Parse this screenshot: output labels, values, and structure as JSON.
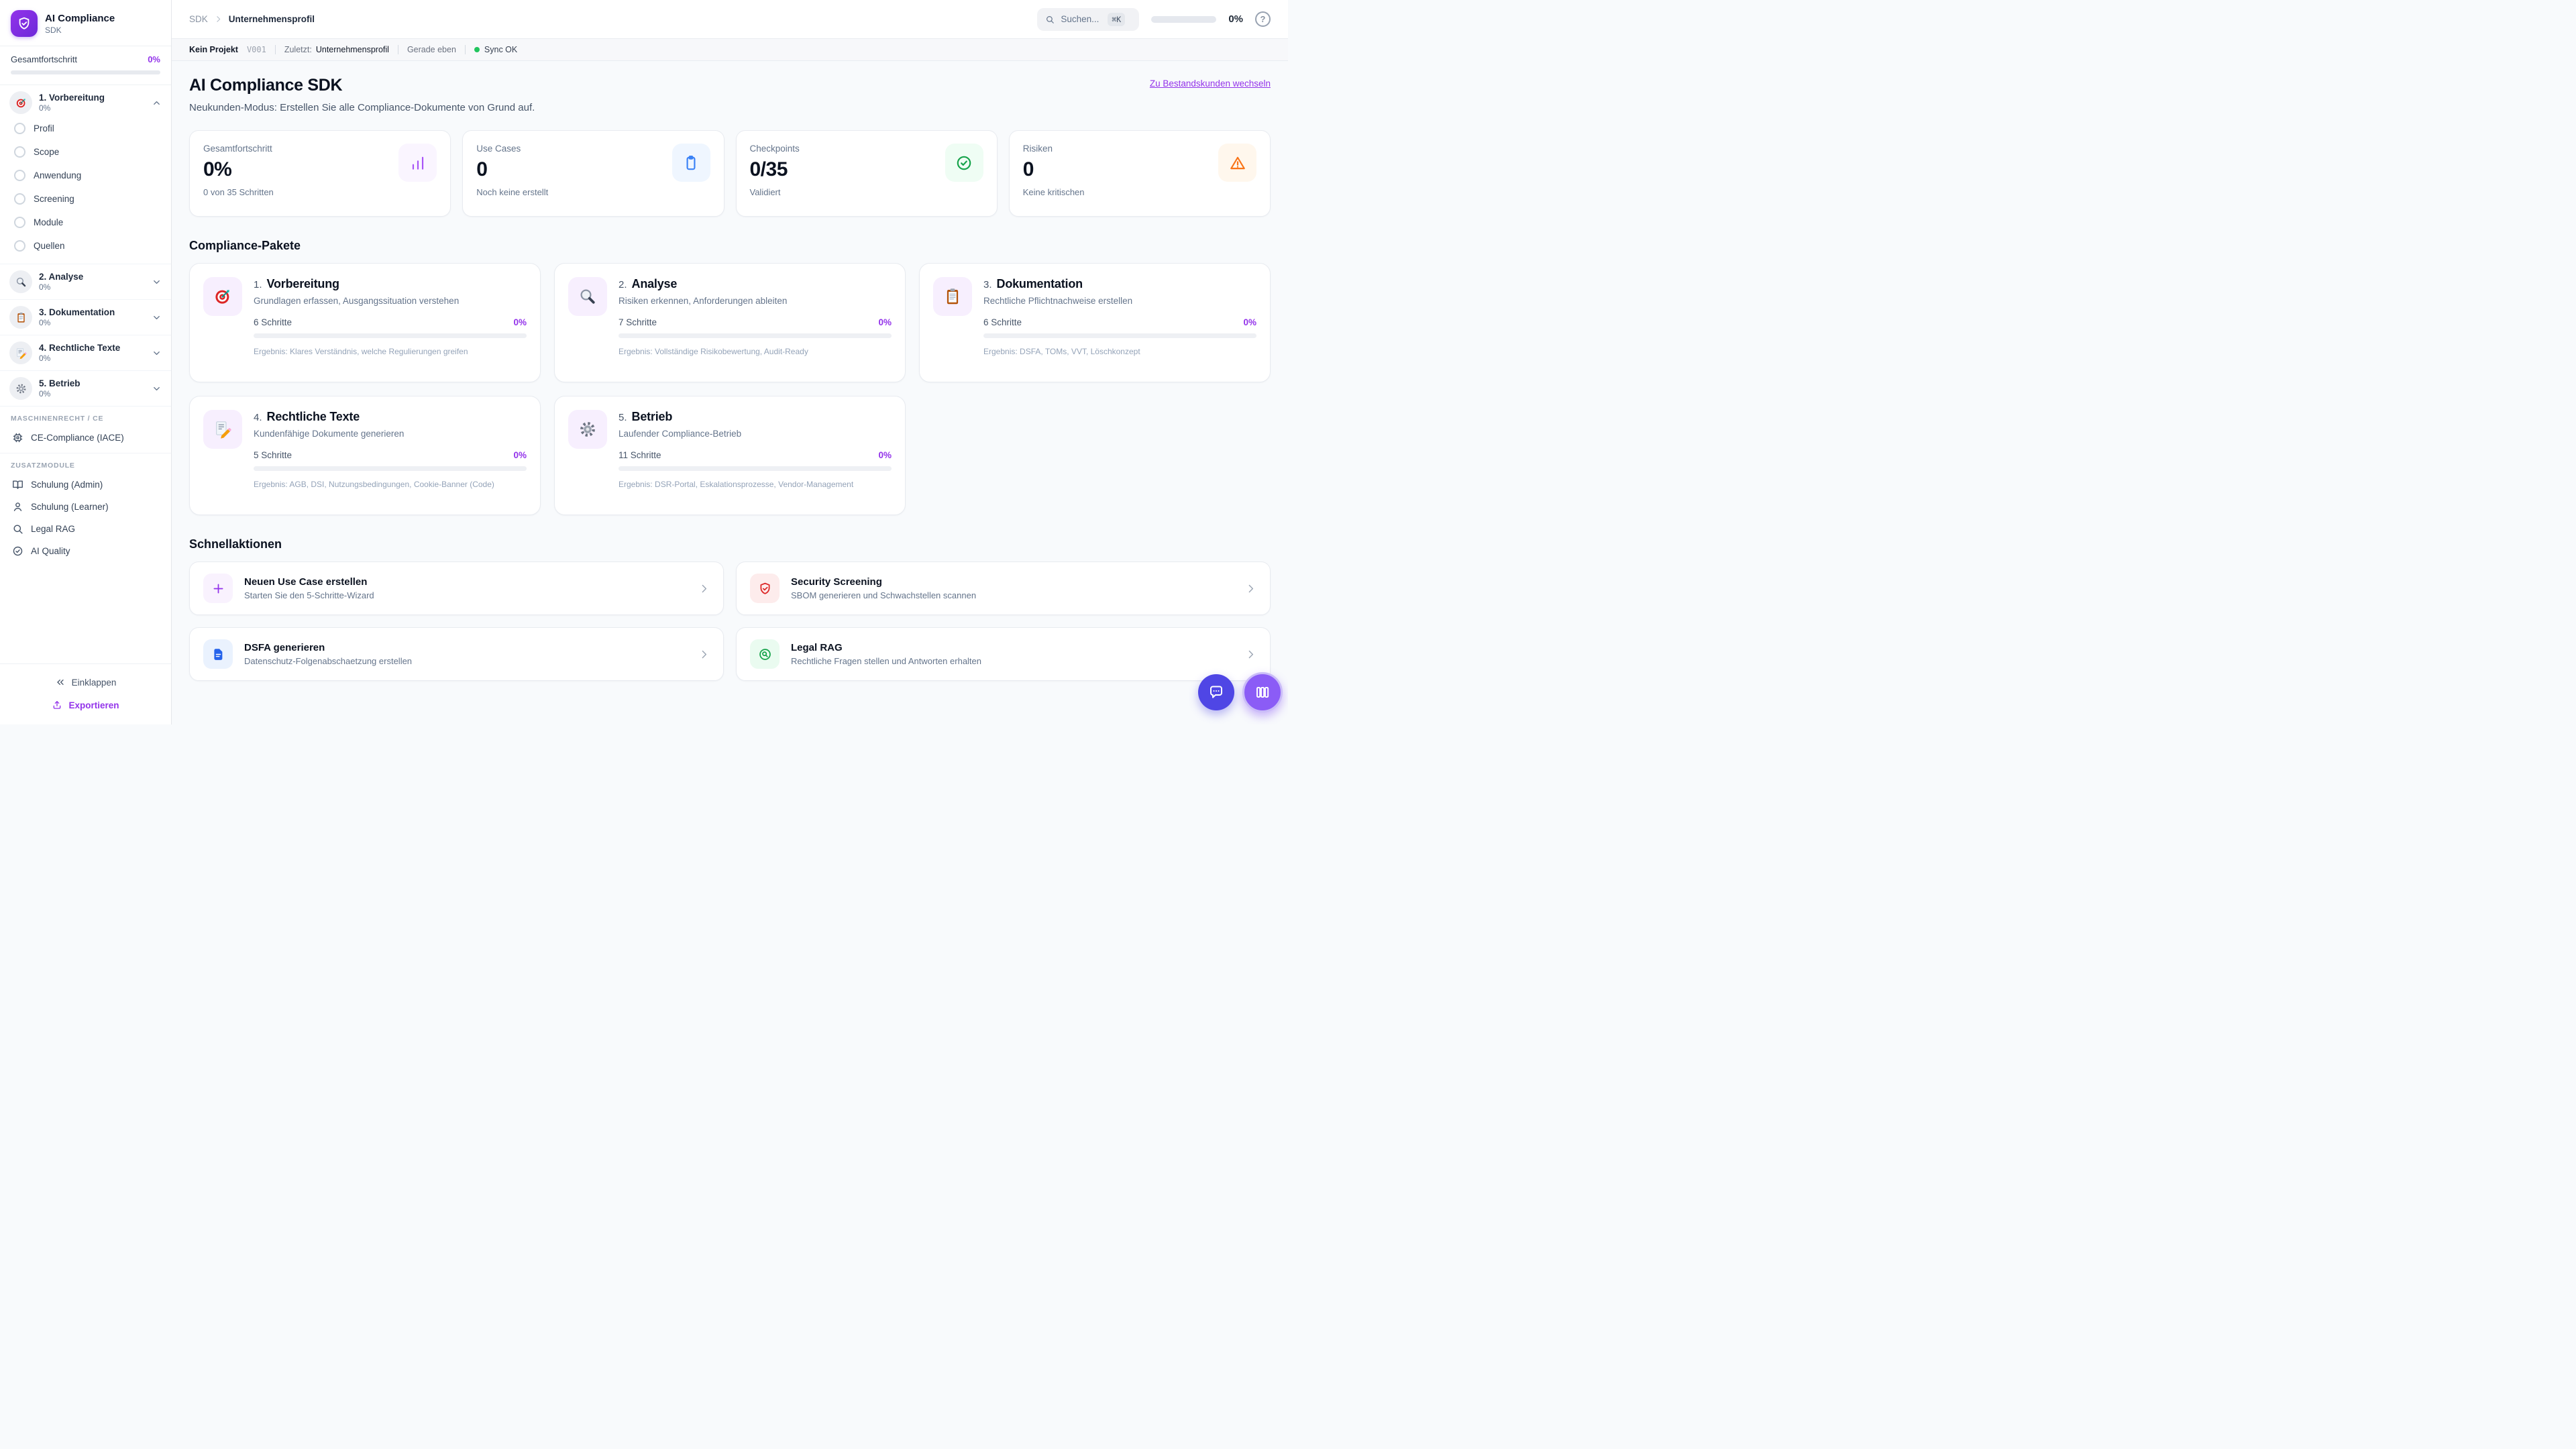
{
  "app": {
    "name": "AI Compliance",
    "subtitle": "SDK"
  },
  "sidebar": {
    "overall": {
      "label": "Gesamtfortschritt",
      "pct": "0%"
    },
    "sections": [
      {
        "label": "1. Vorbereitung",
        "pct": "0%",
        "icon": "target-emoji",
        "expanded": true,
        "children": [
          "Profil",
          "Scope",
          "Anwendung",
          "Screening",
          "Module",
          "Quellen"
        ]
      },
      {
        "label": "2. Analyse",
        "pct": "0%",
        "icon": "magnifier-emoji"
      },
      {
        "label": "3. Dokumentation",
        "pct": "0%",
        "icon": "clipboard-emoji"
      },
      {
        "label": "4. Rechtliche Texte",
        "pct": "0%",
        "icon": "memo-pencil-emoji"
      },
      {
        "label": "5. Betrieb",
        "pct": "0%",
        "icon": "gear-emoji"
      }
    ],
    "groups": [
      {
        "header": "MASCHINENRECHT / CE",
        "items": [
          {
            "label": "CE-Compliance (IACE)",
            "icon": "cpu-chip-icon"
          }
        ]
      },
      {
        "header": "ZUSATZMODULE",
        "items": [
          {
            "label": "Schulung (Admin)",
            "icon": "book-open-icon"
          },
          {
            "label": "Schulung (Learner)",
            "icon": "user-icon"
          },
          {
            "label": "Legal RAG",
            "icon": "search-icon"
          },
          {
            "label": "AI Quality",
            "icon": "check-circle-icon"
          }
        ]
      }
    ],
    "collapse_label": "Einklappen",
    "export_label": "Exportieren"
  },
  "header": {
    "breadcrumb_root": "SDK",
    "breadcrumb_current": "Unternehmensprofil",
    "search_placeholder": "Suchen...",
    "search_kbd": "⌘K",
    "progress_pct": "0%",
    "help_label": "?"
  },
  "statusbar": {
    "project": "Kein Projekt",
    "version": "V001",
    "last_label": "Zuletzt:",
    "last_value": "Unternehmensprofil",
    "time": "Gerade eben",
    "sync": "Sync OK"
  },
  "main": {
    "title": "AI Compliance SDK",
    "subtitle": "Neukunden-Modus: Erstellen Sie alle Compliance-Dokumente von Grund auf.",
    "switch_link": "Zu Bestandskunden wechseln",
    "stats": [
      {
        "label": "Gesamtfortschritt",
        "value": "0%",
        "sub": "0 von 35 Schritten",
        "icon": "bar-chart-icon"
      },
      {
        "label": "Use Cases",
        "value": "0",
        "sub": "Noch keine erstellt",
        "icon": "clipboard-icon"
      },
      {
        "label": "Checkpoints",
        "value": "0/35",
        "sub": "Validiert",
        "icon": "check-circle-icon"
      },
      {
        "label": "Risiken",
        "value": "0",
        "sub": "Keine kritischen",
        "icon": "alert-triangle-icon"
      }
    ],
    "packages_heading": "Compliance-Pakete",
    "packages": [
      {
        "num": "1.",
        "title": "Vorbereitung",
        "desc": "Grundlagen erfassen, Ausgangssituation verstehen",
        "steps": "6 Schritte",
        "pct": "0%",
        "result": "Ergebnis: Klares Verständnis, welche Regulierungen greifen",
        "icon": "target-emoji"
      },
      {
        "num": "2.",
        "title": "Analyse",
        "desc": "Risiken erkennen, Anforderungen ableiten",
        "steps": "7 Schritte",
        "pct": "0%",
        "result": "Ergebnis: Vollständige Risikobewertung, Audit-Ready",
        "icon": "magnifier-emoji"
      },
      {
        "num": "3.",
        "title": "Dokumentation",
        "desc": "Rechtliche Pflichtnachweise erstellen",
        "steps": "6 Schritte",
        "pct": "0%",
        "result": "Ergebnis: DSFA, TOMs, VVT, Löschkonzept",
        "icon": "clipboard-emoji"
      },
      {
        "num": "4.",
        "title": "Rechtliche Texte",
        "desc": "Kundenfähige Dokumente generieren",
        "steps": "5 Schritte",
        "pct": "0%",
        "result": "Ergebnis: AGB, DSI, Nutzungsbedingungen, Cookie-Banner (Code)",
        "icon": "memo-pencil-emoji"
      },
      {
        "num": "5.",
        "title": "Betrieb",
        "desc": "Laufender Compliance-Betrieb",
        "steps": "11 Schritte",
        "pct": "0%",
        "result": "Ergebnis: DSR-Portal, Eskalationsprozesse, Vendor-Management",
        "icon": "gear-emoji"
      }
    ],
    "actions_heading": "Schnellaktionen",
    "actions": [
      {
        "title": "Neuen Use Case erstellen",
        "desc": "Starten Sie den 5-Schritte-Wizard",
        "icon": "plus-icon"
      },
      {
        "title": "Security Screening",
        "desc": "SBOM generieren und Schwachstellen scannen",
        "icon": "shield-check-icon"
      },
      {
        "title": "DSFA generieren",
        "desc": "Datenschutz-Folgenabschaetzung erstellen",
        "icon": "file-text-icon"
      },
      {
        "title": "Legal RAG",
        "desc": "Rechtliche Fragen stellen und Antworten erhalten",
        "icon": "search-circle-icon"
      }
    ]
  },
  "colors": {
    "accent_purple": "#9333ea",
    "icon_purple": "#a855f7",
    "blue": "#3b82f6",
    "green": "#22c55e",
    "orange": "#f97316",
    "red": "#dc2626",
    "fab_indigo": "#4f46e5",
    "fab_violet": "#8b5cf6",
    "background": "#f8fafc"
  }
}
